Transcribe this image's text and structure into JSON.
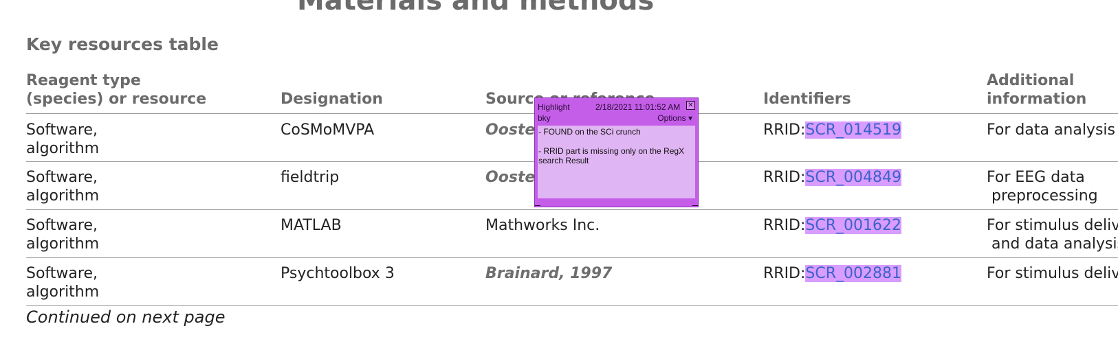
{
  "heading": "Materials and methods",
  "subheading": "Key resources table",
  "columns": {
    "reagent_line1": "Reagent type",
    "reagent_line2": "(species) or resource",
    "designation": "Designation",
    "source": "Source or reference",
    "identifiers": "Identifiers",
    "additional_line1": "Additional",
    "additional_line2": "information"
  },
  "rows": [
    {
      "type_line1": "Software,",
      "type_line2": "algorithm",
      "designation": "CoSMoMVPA",
      "source": "Oosterhof et al., 2016",
      "rrid_prefix": "RRID:",
      "rrid": "SCR_014519",
      "info_line1": "For data analysis",
      "info_line2": ""
    },
    {
      "type_line1": "Software,",
      "type_line2": "algorithm",
      "designation": "fieldtrip",
      "source": "Oostenveld et al., 2011",
      "rrid_prefix": "RRID:",
      "rrid": "SCR_004849",
      "info_line1": "For EEG data",
      "info_line2": " preprocessing"
    },
    {
      "type_line1": "Software,",
      "type_line2": "algorithm",
      "designation": "MATLAB",
      "source": "Mathworks Inc.",
      "rrid_prefix": "RRID:",
      "rrid": "SCR_001622",
      "info_line1": "For stimulus delivery",
      "info_line2": " and data analysis"
    },
    {
      "type_line1": "Software,",
      "type_line2": "algorithm",
      "designation": "Psychtoolbox 3",
      "source": "Brainard, 1997",
      "rrid_prefix": "RRID:",
      "rrid": "SCR_002881",
      "info_line1": "For stimulus delivery",
      "info_line2": ""
    }
  ],
  "footer": "Continued on next page",
  "annotation": {
    "type": "Highlight",
    "date": "2/18/2021 11:01:52 AM",
    "author": "bky",
    "options": "Options ▾",
    "close": "✕",
    "text": "- FOUND on the SCi crunch\n\n- RRID part is missing only on the RegX search Result"
  }
}
